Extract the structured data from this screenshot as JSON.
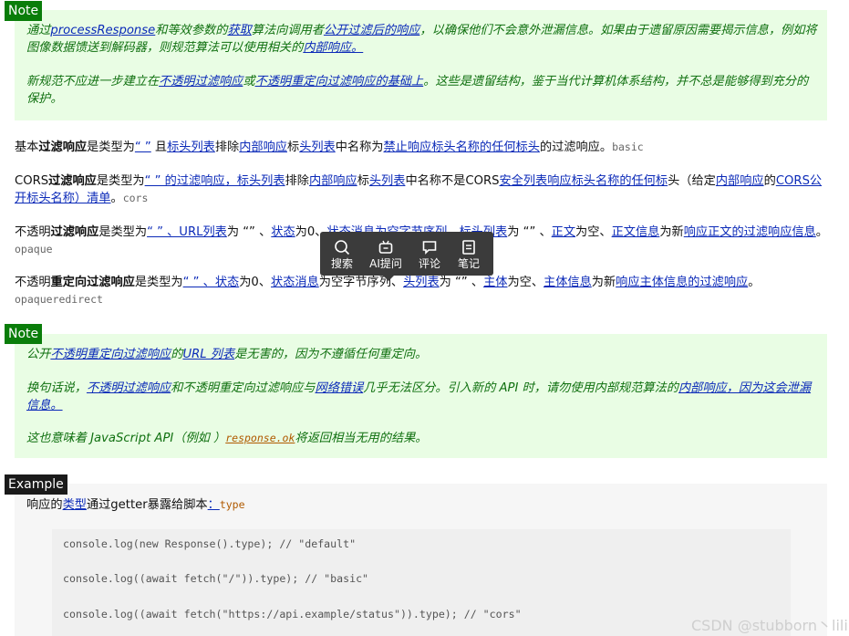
{
  "note1": {
    "tag": "Note",
    "p1": {
      "s1": "通过",
      "l1": "processResponse",
      "s2": "和等效参数的",
      "l2": "获取",
      "s3": "算法向调用者",
      "l3": "公开过滤后的响应",
      "s4": "，以确保他们不会意外泄漏信息。如果由于遗留原因需要揭示信息，例如将图像数据馈送到解码器，则规范算法可以使用相关的",
      "l4": "内部响应。"
    },
    "p2": {
      "s1": "新规范不应进一步建立在",
      "l1": "不透明过滤响应",
      "s2": "或",
      "l2": "不透明重定向过滤响应的基础上",
      "s3": "。这些是遗留结构，鉴于当代计算机体系结构，并不总是能够得到充分的保护。"
    }
  },
  "basic": {
    "s1": "基本",
    "b1": "过滤响应",
    "s2": "是类型为",
    "l1": "“ ”",
    "s3": " 且",
    "l2": "标头列表",
    "s4": "排除",
    "l3": "内部响应",
    "s5": "标",
    "l4": "头列表",
    "s6": "中名称为",
    "l5": "禁止响应标头名称的任何标头",
    "s7": "的过滤响应。",
    "code": "basic"
  },
  "cors": {
    "s1": "CORS",
    "b1": "过滤响应",
    "s2": "是类型为",
    "l1": "“ ” 的过滤响应，标头列表",
    "s3": "排除",
    "l2": "内部响应",
    "s4": "标",
    "l3": "头列表",
    "s5": "中名称不是CORS",
    "l4": "安全列表响应标头名称的任何标",
    "s6": "头（给定",
    "l5": "内部响应",
    "s7": "的",
    "l6": "CORS公开标头名称）清单",
    "s8": "。",
    "code": "cors"
  },
  "opaque": {
    "s1": "不透明",
    "b1": "过滤响应",
    "s2": "是类型为",
    "l1": "“ ” 、URL列表",
    "s3": "为 “” 、",
    "l2": "状态",
    "s4": "为0、",
    "l3": "状态消息为空字节序列",
    "s5": "、",
    "l4": "标头列表",
    "s6": "为 “” 、",
    "l5": "正文",
    "s7": "为空、",
    "l6": "正文信息",
    "s8": "为新",
    "l7": "响应正文的过滤响应信息",
    "s9": "。",
    "code": "opaque"
  },
  "opaqueredirect": {
    "s1": "不透明",
    "b1": "重定向过滤响应",
    "s2": "是类型为",
    "l1": "“ ” 、状态",
    "s3": "为0、",
    "l2": "状态消息",
    "s4": "为空字节序列、",
    "l3": "头列表",
    "s5": "为 “” 、",
    "l4": "主体",
    "s6": "为空、",
    "l5": "主体信息",
    "s7": "为新",
    "l6": "响应主体信息的过滤响应",
    "s8": "。",
    "code": "opaqueredirect"
  },
  "note2": {
    "tag": "Note",
    "p1": {
      "s1": "公开",
      "l1": "不透明重定向过滤响应",
      "s2": "的",
      "l2": "URL 列表",
      "s3": "是无害的，因为不遵循任何重定向。"
    },
    "p2": {
      "s1": "换句话说，",
      "l1": "不透明过滤响应",
      "s2": "和不透明重定向过滤响应与",
      "l2": "网络错误",
      "s3": "几乎无法区分。引入新的 API 时，请勿使用内部规范算法的",
      "l3": "内部响应，因为这会泄漏信息。"
    },
    "p3": {
      "s1": "这也意味着 JavaScript API（例如 ）",
      "code": "response.ok",
      "s2": "将返回相当无用的结果。"
    }
  },
  "example": {
    "tag": "Example",
    "intro": {
      "s1": "响应的",
      "l1": "类型",
      "s2": "通过getter暴露给脚本",
      "l2": "：",
      "code": "type"
    },
    "lines": [
      "console.log(new Response().type); // \"default\"",
      "console.log((await fetch(\"/\")).type); // \"basic\"",
      "console.log((await fetch(\"https://api.example/status\")).type); // \"cors\""
    ]
  },
  "toolbar": {
    "items": [
      {
        "label": "搜索",
        "icon": "search-icon"
      },
      {
        "label": "AI提问",
        "icon": "ai-robot-icon"
      },
      {
        "label": "评论",
        "icon": "comment-icon"
      },
      {
        "label": "笔记",
        "icon": "note-icon"
      }
    ]
  },
  "watermark": "CSDN @stubborn丶lili"
}
